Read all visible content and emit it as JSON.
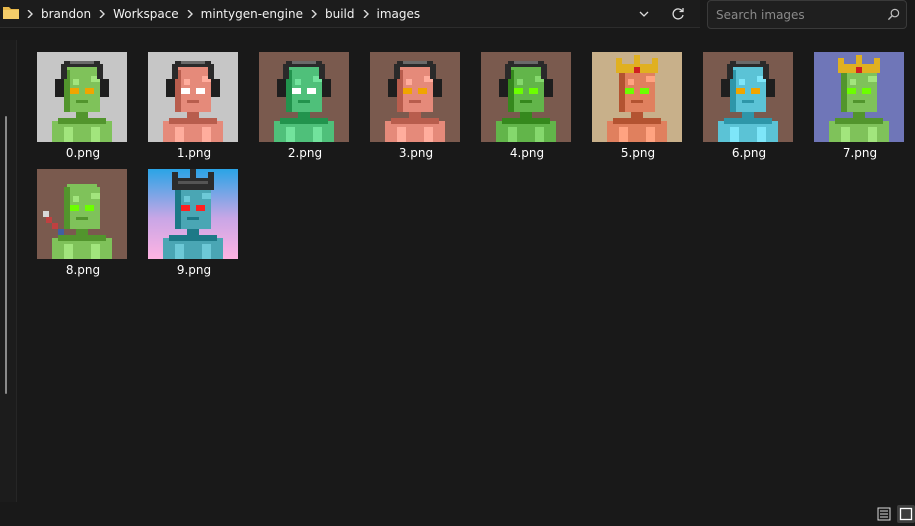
{
  "breadcrumb": {
    "items": [
      "brandon",
      "Workspace",
      "mintygen-engine",
      "build",
      "images"
    ]
  },
  "search": {
    "placeholder": "Search images"
  },
  "icons": {
    "folder": "folder-icon",
    "chevron": "chevron-right-icon",
    "dropdown": "chevron-down-icon",
    "refresh": "refresh-icon",
    "search": "search-icon",
    "details_view": "details-view-icon",
    "large_icons_view": "large-icons-view-icon"
  },
  "colors": {
    "folder": "#e8b84a",
    "text": "#ffffff",
    "muted": "#8a8a8a"
  },
  "files": [
    {
      "name": "0.png",
      "bg": "#c6c6c6",
      "skin": "#7fc25a",
      "eyes": "#f0a500",
      "hat": "headphones"
    },
    {
      "name": "1.png",
      "bg": "#c6c6c6",
      "skin": "#e58a7a",
      "eyes": "#ffffff",
      "hat": "headphones"
    },
    {
      "name": "2.png",
      "bg": "#7a5a4e",
      "skin": "#4fc07a",
      "eyes": "#ffffff",
      "hat": "headphones"
    },
    {
      "name": "3.png",
      "bg": "#7a5a4e",
      "skin": "#e58a7a",
      "eyes": "#f0a500",
      "hat": "headphones"
    },
    {
      "name": "4.png",
      "bg": "#7a5a4e",
      "skin": "#62b54a",
      "eyes": "#6cff00",
      "hat": "headphones"
    },
    {
      "name": "5.png",
      "bg": "#c8b08a",
      "skin": "#e0805e",
      "eyes": "#6cff00",
      "hat": "crown"
    },
    {
      "name": "6.png",
      "bg": "#7a5a4e",
      "skin": "#5bc3d6",
      "eyes": "#f0a500",
      "hat": "headphones"
    },
    {
      "name": "7.png",
      "bg": "#6f76b8",
      "skin": "#7fc25a",
      "eyes": "#6cff00",
      "hat": "crown"
    },
    {
      "name": "8.png",
      "bg": "#7a5a4e",
      "skin": "#7fc25a",
      "eyes": "#6cff00",
      "hat": "none"
    },
    {
      "name": "9.png",
      "bg": "gradient",
      "skin": "#4aa6b4",
      "eyes": "#ff2020",
      "hat": "dark-crown"
    }
  ]
}
